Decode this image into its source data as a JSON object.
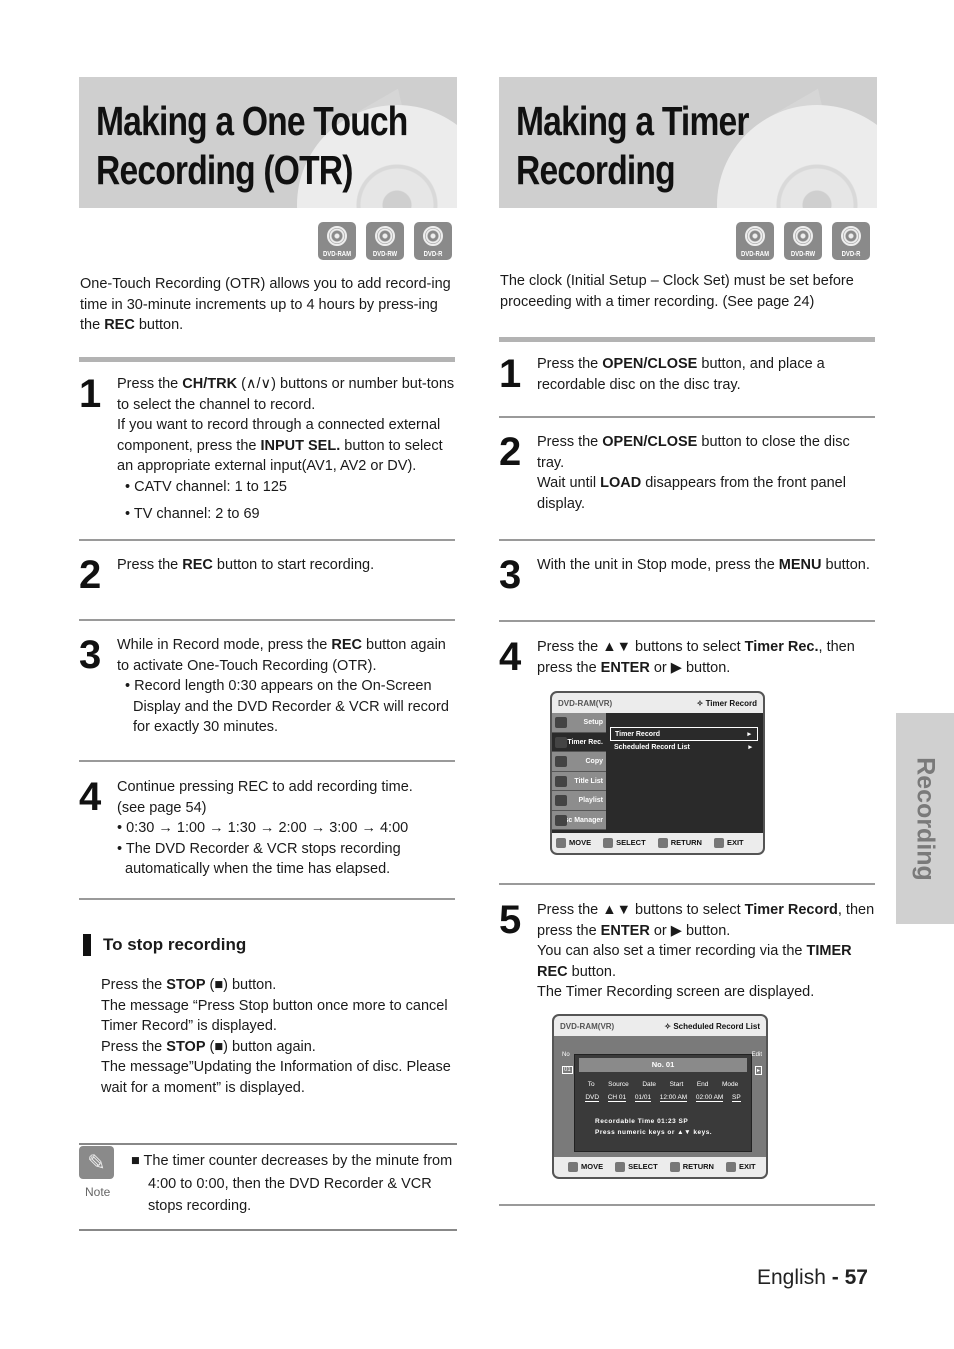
{
  "left": {
    "title_line1": "Making a One Touch",
    "title_line2": "Recording (OTR)",
    "disc_badges": [
      "DVD-RAM",
      "DVD-RW",
      "DVD-R"
    ],
    "intro_pre": "One-Touch Recording (OTR) allows you to add record-ing time in 30-minute increments up to 4 hours by press-ing the ",
    "intro_bold": "REC",
    "intro_post": " button.",
    "steps": [
      {
        "num": "1",
        "p1_pre": "Press the ",
        "p1_bold": "CH/TRK",
        "p1_post": " (∧/∨) buttons or number but-tons to select the channel to record.",
        "p2_pre": "If you want to record through a connected external component, press the ",
        "p2_bold": "INPUT SEL.",
        "p2_post": " button to select an appropriate external input(AV1, AV2 or DV).",
        "bullet1": "• CATV channel: 1 to 125",
        "bullet2": "• TV channel: 2 to 69"
      },
      {
        "num": "2",
        "pre": "Press the ",
        "bold": "REC",
        "post": " button to start recording."
      },
      {
        "num": "3",
        "pre": "While in Record mode, press the ",
        "bold": "REC",
        "post": " button again to activate One-Touch Recording (OTR).",
        "bullet": "• Record length 0:30 appears on the On-Screen Display and the DVD Recorder & VCR will record for exactly 30 minutes."
      },
      {
        "num": "4",
        "line1": "Continue pressing REC to add recording time.",
        "line2": "(see page 54)",
        "bullet1": "• 0:30 → 1:00 → 1:30 → 2:00 → 3:00 → 4:00",
        "bullet2": "• The DVD Recorder & VCR stops recording automatically when the time has elapsed."
      }
    ],
    "stop": {
      "heading": "To stop recording",
      "l1_pre": "Press the ",
      "l1_bold": "STOP",
      "l1_post": " (■) button.",
      "l2": "The message “Press Stop button once more to cancel Timer Record” is displayed.",
      "l3_pre": "Press the ",
      "l3_bold": "STOP",
      "l3_post": " (■) button again.",
      "l4": "The message”Updating the Information of disc. Please wait for a moment” is displayed."
    },
    "note": {
      "label": "Note",
      "text": "■ The timer counter decreases by the minute from 4:00 to 0:00, then the DVD Recorder & VCR stops recording."
    }
  },
  "right": {
    "title_line1": "Making a Timer",
    "title_line2": "Recording",
    "disc_badges": [
      "DVD-RAM",
      "DVD-RW",
      "DVD-R"
    ],
    "intro": "The clock (Initial Setup – Clock Set) must be set before proceeding with a timer recording. (See page 24)",
    "steps": [
      {
        "num": "1",
        "pre": "Press the ",
        "bold": "OPEN/CLOSE",
        "post": " button, and place a recordable disc on the disc tray."
      },
      {
        "num": "2",
        "pre": "Press the ",
        "bold": "OPEN/CLOSE",
        "post": " button to close the disc tray.",
        "l2_pre": "Wait until ",
        "l2_bold": "LOAD",
        "l2_post": " disappears from the front panel display."
      },
      {
        "num": "3",
        "pre": "With the unit in Stop mode, press the ",
        "bold": "MENU",
        "post": " button."
      },
      {
        "num": "4",
        "pre": "Press the ▲▼  buttons to select ",
        "bold": "Timer Rec.",
        "mid": ", then press the ",
        "bold2": "ENTER",
        "post": " or ▶ button."
      },
      {
        "num": "5",
        "pre": "Press the ▲▼ buttons to select ",
        "bold": "Timer Record",
        "mid": ", then press the ",
        "bold2": "ENTER",
        "post": " or ▶ button.",
        "l2_pre": "You can also set a timer recording via the ",
        "l2_bold": "TIMER REC",
        "l2_post": " button.",
        "l3": "The Timer Recording screen are displayed."
      }
    ],
    "osd1": {
      "header_left": "DVD-RAM(VR)",
      "header_right": "✧ Timer Record",
      "side_items": [
        "Setup",
        "Timer Rec.",
        "Copy",
        "Title List",
        "Playlist",
        "Disc Manager"
      ],
      "menu_items": [
        "Timer Record",
        "Scheduled Record List"
      ],
      "footer": [
        "MOVE",
        "SELECT",
        "RETURN",
        "EXIT"
      ]
    },
    "osd2": {
      "header_left": "DVD-RAM(VR)",
      "header_right": "✧ Scheduled Record List",
      "bg_left_label": "No",
      "bg_left_value": "01",
      "bg_right_label": "Edit",
      "dialog_title": "No. 01",
      "columns": [
        "To",
        "Source",
        "Date",
        "Start",
        "End",
        "Mode"
      ],
      "values": [
        "DVD",
        "CH 01",
        "01/01",
        "12:00 AM",
        "02:00 AM",
        "SP"
      ],
      "msg1": "Recordable Time 01:23 SP",
      "msg2": "Press numeric keys or ▲▼ keys.",
      "footer": [
        "MOVE",
        "SELECT",
        "RETURN",
        "EXIT"
      ]
    }
  },
  "side_tab": "Recording",
  "footer": {
    "lang": "English",
    "sep": " - ",
    "page": "57"
  }
}
